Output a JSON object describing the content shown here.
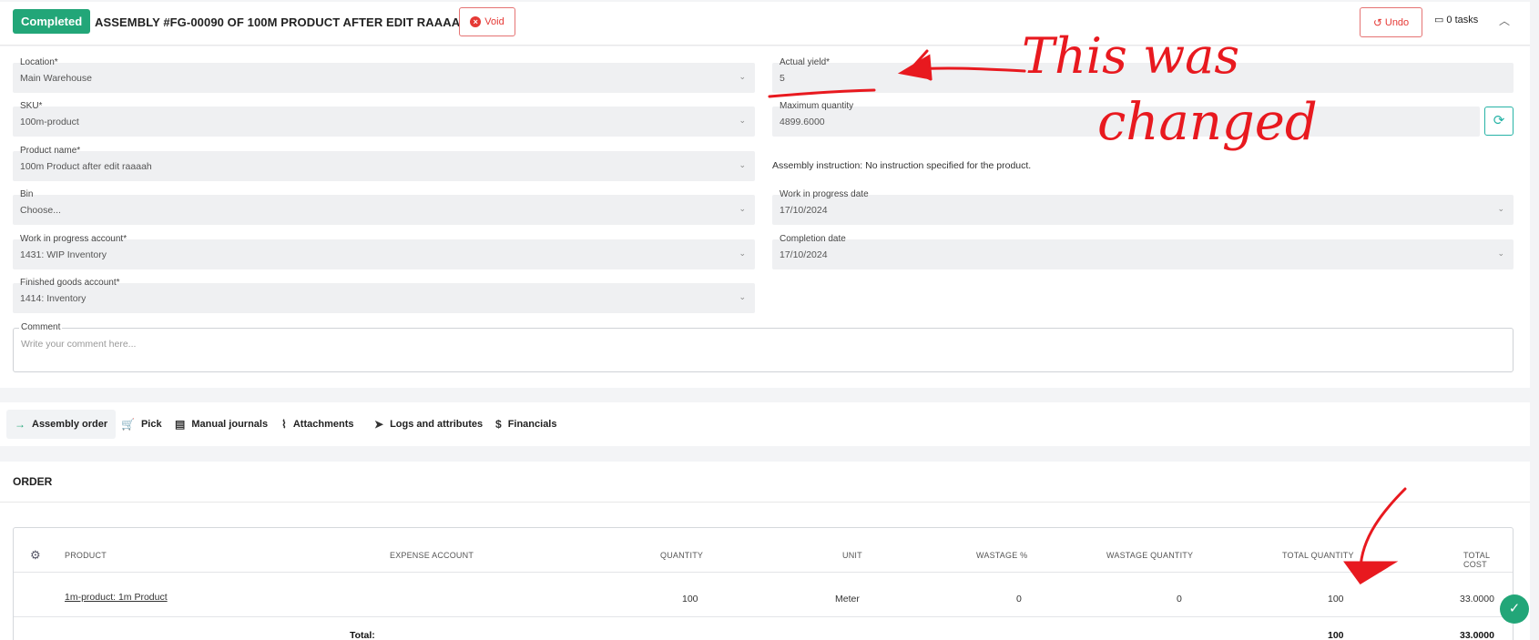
{
  "header": {
    "status_badge": "Completed",
    "title": "ASSEMBLY #FG-00090 OF 100M PRODUCT AFTER EDIT RAAAAH",
    "void_label": "Void",
    "undo_label": "Undo",
    "tasks_label": "0 tasks"
  },
  "form": {
    "location": {
      "label": "Location*",
      "value": "Main Warehouse"
    },
    "sku": {
      "label": "SKU*",
      "value": "100m-product"
    },
    "product_name": {
      "label": "Product name*",
      "value": "100m Product after edit raaaah"
    },
    "bin": {
      "label": "Bin",
      "value": "Choose..."
    },
    "wip_account": {
      "label": "Work in progress account*",
      "value": "1431: WIP Inventory"
    },
    "finished_goods_account": {
      "label": "Finished goods account*",
      "value": "1414: Inventory"
    },
    "actual_yield": {
      "label": "Actual yield*",
      "value": "5"
    },
    "maximum_quantity": {
      "label": "Maximum quantity",
      "value": "4899.6000"
    },
    "assembly_instruction": "Assembly instruction: No instruction specified for the product.",
    "wip_date": {
      "label": "Work in progress date",
      "value": "17/10/2024"
    },
    "completion_date": {
      "label": "Completion date",
      "value": "17/10/2024"
    },
    "comment": {
      "label": "Comment",
      "placeholder": "Write your comment here..."
    }
  },
  "tabs": [
    {
      "label": "Assembly order",
      "icon": "arrow-right-icon"
    },
    {
      "label": "Pick",
      "icon": "cart-icon"
    },
    {
      "label": "Manual journals",
      "icon": "journal-icon"
    },
    {
      "label": "Attachments",
      "icon": "paperclip-icon"
    },
    {
      "label": "Logs and attributes",
      "icon": "tag-icon"
    },
    {
      "label": "Financials",
      "icon": "dollar-icon"
    }
  ],
  "order": {
    "title": "ORDER",
    "columns": [
      "PRODUCT",
      "EXPENSE ACCOUNT",
      "QUANTITY",
      "UNIT",
      "WASTAGE %",
      "WASTAGE QUANTITY",
      "TOTAL QUANTITY",
      "TOTAL COST"
    ],
    "rows": [
      {
        "product": "1m-product: 1m Product",
        "expense_account": "",
        "quantity": "100",
        "unit": "Meter",
        "wastage_pct": "0",
        "wastage_qty": "0",
        "total_qty": "100",
        "total_cost": "33.0000"
      }
    ],
    "total": {
      "label": "Total:",
      "total_qty": "100",
      "total_cost": "33.0000"
    }
  },
  "annotation": {
    "line1": "This was",
    "line2": "changed",
    "color": "#e8191f"
  },
  "colors": {
    "accent": "#22a678",
    "danger": "#e53935",
    "teal": "#26b3a6"
  }
}
